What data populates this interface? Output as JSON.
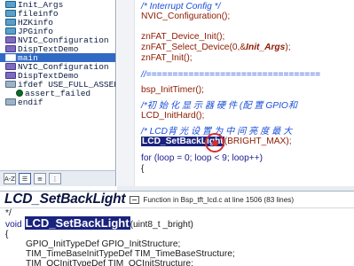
{
  "symbols": [
    {
      "label": "Init_Args",
      "type": "var"
    },
    {
      "label": "fileinfo",
      "type": "var"
    },
    {
      "label": "HZKinfo",
      "type": "var"
    },
    {
      "label": "JPGinfo",
      "type": "var"
    },
    {
      "label": "NVIC_Configuration",
      "type": "func"
    },
    {
      "label": "DispTextDemo",
      "type": "func"
    },
    {
      "label": "main",
      "type": "func",
      "selected": true
    },
    {
      "label": "NVIC_Configuration",
      "type": "func"
    },
    {
      "label": "DispTextDemo",
      "type": "func"
    },
    {
      "label": "ifdef USE_FULL_ASSERT",
      "type": "macro"
    },
    {
      "label": "assert_failed",
      "type": "sub"
    },
    {
      "label": "endif",
      "type": "macro"
    }
  ],
  "symbol_toolbar": {
    "az_label": "A-Z"
  },
  "editor": {
    "lines": [
      {
        "text": "/* Interrupt Config */",
        "style": "comment"
      },
      {
        "text": "NVIC_Configuration();",
        "style": "fn"
      },
      {
        "text": "",
        "style": "plain"
      },
      {
        "text": "znFAT_Device_Init();",
        "style": "fn"
      },
      {
        "text": "znFAT_Select_Device(0,&",
        "style": "fn",
        "param": "Init_Args",
        "tail": ");"
      },
      {
        "text": "znFAT_Init();",
        "style": "fn"
      },
      {
        "text": "",
        "style": "plain"
      },
      {
        "text": "//=================================",
        "style": "comment"
      },
      {
        "text": "",
        "style": "plain"
      },
      {
        "text": "bsp_InitTimer();",
        "style": "fn"
      },
      {
        "text": "",
        "style": "plain"
      },
      {
        "text": "/*初 始 化 显 示 器 硬 件 (配 置  GPIO和",
        "style": "comment"
      },
      {
        "text": "LCD_InitHard();",
        "style": "fn"
      },
      {
        "text": "",
        "style": "plain"
      },
      {
        "text": "/* LCD背 光 设 置 为 中 间 亮 度  最 大",
        "style": "comment"
      },
      {
        "text": "LCD_SetBackLight",
        "style": "selected",
        "tail": "(BRIGHT_MAX);"
      },
      {
        "text": "",
        "style": "plain"
      },
      {
        "text": "for (loop = 0; loop < 9; loop++)",
        "style": "kw"
      },
      {
        "text": "{",
        "style": "plain"
      }
    ]
  },
  "context": {
    "symbol": "LCD_SetBackLight",
    "info": "Function in Bsp_tft_lcd.c at line 1506 (83 lines)",
    "lines": [
      {
        "pre": "*/",
        "sel": "",
        "post": ""
      },
      {
        "pre": "void ",
        "sel": "LCD_SetBackLight",
        "post": "(uint8_t _bright)"
      },
      {
        "pre": "{",
        "sel": "",
        "post": ""
      },
      {
        "pre": "GPIO_InitTypeDef GPIO_InitStructure;",
        "sel": "",
        "post": ""
      },
      {
        "pre": "TIM_TimeBaseInitTypeDef TIM_TimeBaseStructure;",
        "sel": "",
        "post": ""
      },
      {
        "pre": "TIM_OCInitTypeDef TIM_OCInitStructure;",
        "sel": "",
        "post": ""
      }
    ]
  }
}
